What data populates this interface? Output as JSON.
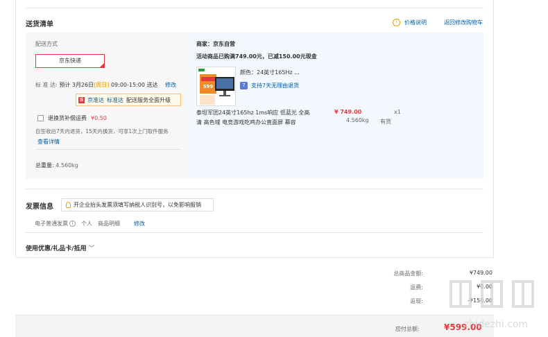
{
  "header": {
    "title": "送货清单",
    "price_note": "价格说明",
    "back_to_cart": "返回修改购物车"
  },
  "delivery": {
    "method_label": "配送方式",
    "method_selected": "京东快递",
    "standard_label": "标 准 达:",
    "standard_text_a": "预计 3月26日",
    "standard_day": "[周日]",
    "standard_text_b": "09:00-15:00 送达",
    "modify": "修改",
    "tooltip_a": "京准达",
    "tooltip_b": "标准达",
    "tooltip_c": "配送服务全面升级",
    "return_fee_label": "退换货补偿运费",
    "return_fee_price": "¥0.50",
    "return_desc": "自签收后7天内退货，15天内换货，可享1次上门取件服务",
    "view_details": "查看详情",
    "total_weight_label": "总重量:",
    "total_weight_value": "4.560kg"
  },
  "product": {
    "merchant": "商家：京东自营",
    "promo": "活动商品已购满749.00元，已减150.00元现金",
    "color": "颜色：24英寸165Hz ...",
    "return_policy": "支持7天无理由退货",
    "name_line1": "泰坦军团24英寸165hz 1ms响应 低蓝光 全高",
    "name_line2": "清 高色域 电竞游戏吃鸡办公直面屏 幕容",
    "price": "¥ 749.00",
    "weight": "4.560kg",
    "qty": "x1",
    "stock": "有货",
    "image_badge": "599"
  },
  "invoice": {
    "title": "发票信息",
    "tip": "开企业抬头发票须填写纳税人识别号，以免影响报销",
    "type": "电子普通发票",
    "person": "个人",
    "detail": "商品明细",
    "modify": "修改"
  },
  "coupons": {
    "title": "使用优惠/礼品卡/抵用",
    "chevron": "﹀"
  },
  "summary": {
    "goods_total_label": "总商品金额:",
    "goods_total_value": "¥749.00",
    "shipping_label": "运费:",
    "shipping_value": "¥0.00",
    "discount_label": "返现:",
    "discount_value": "-¥150.00",
    "payable_label": "应付总额:",
    "payable_value": "¥599.00"
  },
  "watermark": {
    "text": "值 值 值",
    "sub": "zhidezhi.com"
  },
  "colors": {
    "accent_red": "#e4393c",
    "link_blue": "#005ea7",
    "highlight_bg": "#f3f8fe",
    "warn_orange": "#e4a100"
  }
}
